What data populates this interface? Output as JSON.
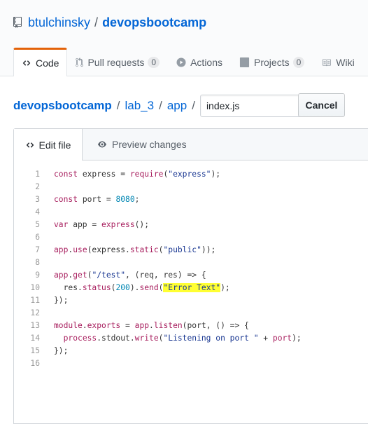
{
  "repo": {
    "owner": "btulchinsky",
    "separator": "/",
    "name": "devopsbootcamp"
  },
  "tabs": [
    {
      "label": "Code",
      "icon": "code-icon",
      "selected": true
    },
    {
      "label": "Pull requests",
      "icon": "pull-request-icon",
      "count": "0"
    },
    {
      "label": "Actions",
      "icon": "play-icon"
    },
    {
      "label": "Projects",
      "icon": "project-icon",
      "count": "0"
    },
    {
      "label": "Wiki",
      "icon": "book-icon"
    }
  ],
  "breadcrumb": {
    "root": "devopsbootcamp",
    "parts": [
      "lab_3",
      "app"
    ],
    "separator": "/",
    "filename_value": "index.js"
  },
  "cancel_label": "Cancel",
  "editor": {
    "tab_edit": "Edit file",
    "tab_preview": "Preview changes"
  },
  "code_lines": [
    {
      "n": "1",
      "text": "const express = require(\"express\");"
    },
    {
      "n": "2",
      "text": ""
    },
    {
      "n": "3",
      "text": "const port = 8080;"
    },
    {
      "n": "4",
      "text": ""
    },
    {
      "n": "5",
      "text": "var app = express();"
    },
    {
      "n": "6",
      "text": ""
    },
    {
      "n": "7",
      "text": "app.use(express.static(\"public\"));"
    },
    {
      "n": "8",
      "text": ""
    },
    {
      "n": "9",
      "text": "app.get(\"/test\", (req, res) => {"
    },
    {
      "n": "10",
      "text": "  res.status(200).send(\"Error Text\");"
    },
    {
      "n": "11",
      "text": "});"
    },
    {
      "n": "12",
      "text": ""
    },
    {
      "n": "13",
      "text": "module.exports = app.listen(port, () => {"
    },
    {
      "n": "14",
      "text": "  process.stdout.write(\"Listening on port \" + port);"
    },
    {
      "n": "15",
      "text": "});"
    },
    {
      "n": "16",
      "text": ""
    }
  ],
  "highlighted_text": "\"Error Text\"",
  "colors": {
    "link": "#0366d6",
    "selected_tab_accent": "#e36209",
    "highlight": "#ffff33"
  }
}
